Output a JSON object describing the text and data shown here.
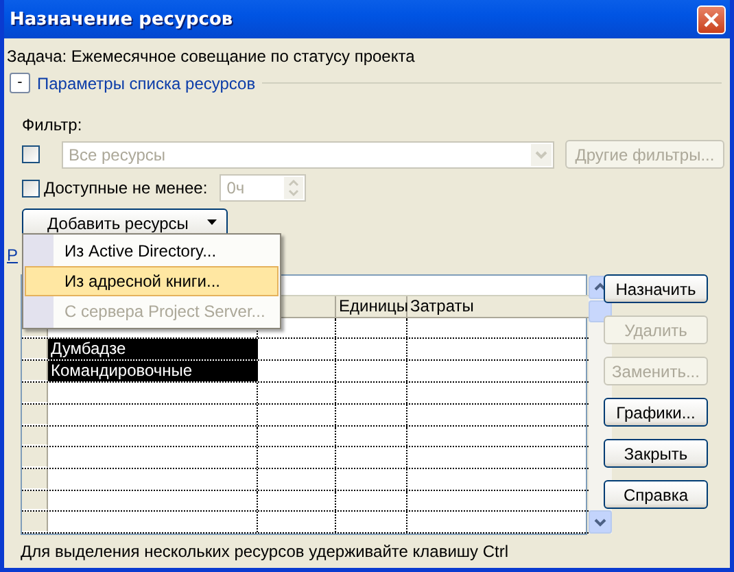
{
  "window": {
    "title": "Назначение ресурсов"
  },
  "task": "Задача: Ежемесячное совещание по статусу проекта",
  "options_section": {
    "toggle": "-",
    "label": "Параметры списка ресурсов"
  },
  "filter": {
    "label": "Фильтр:",
    "checked": false,
    "value": "Все ресурсы",
    "disabled": true,
    "more_button": {
      "label": "Другие фильтры...",
      "disabled": true
    }
  },
  "available": {
    "label": "Доступные не менее:",
    "checked": false,
    "value": "0ч",
    "disabled": true
  },
  "add_button": {
    "label": "Добавить ресурсы"
  },
  "add_menu": [
    {
      "label": "Из Active Directory...",
      "selected": false,
      "disabled": false
    },
    {
      "label": "Из адресной книги...",
      "selected": true,
      "disabled": false
    },
    {
      "label": "С сервера Project Server...",
      "selected": false,
      "disabled": true
    }
  ],
  "link_fragment": "Р",
  "table": {
    "columns": [
      "Единицы",
      "Затраты"
    ],
    "rows": [
      {
        "name": "Думбадзе",
        "selected": true
      },
      {
        "name": "Командировочные",
        "selected": true
      }
    ]
  },
  "buttons": [
    {
      "label": "Назначить",
      "disabled": false
    },
    {
      "label": "Удалить",
      "disabled": true
    },
    {
      "label": "Заменить...",
      "disabled": true
    },
    {
      "label": "Графики...",
      "disabled": false
    },
    {
      "label": "Закрыть",
      "disabled": false
    },
    {
      "label": "Справка",
      "disabled": false
    }
  ],
  "hint": "Для выделения нескольких ресурсов удерживайте клавишу Ctrl"
}
